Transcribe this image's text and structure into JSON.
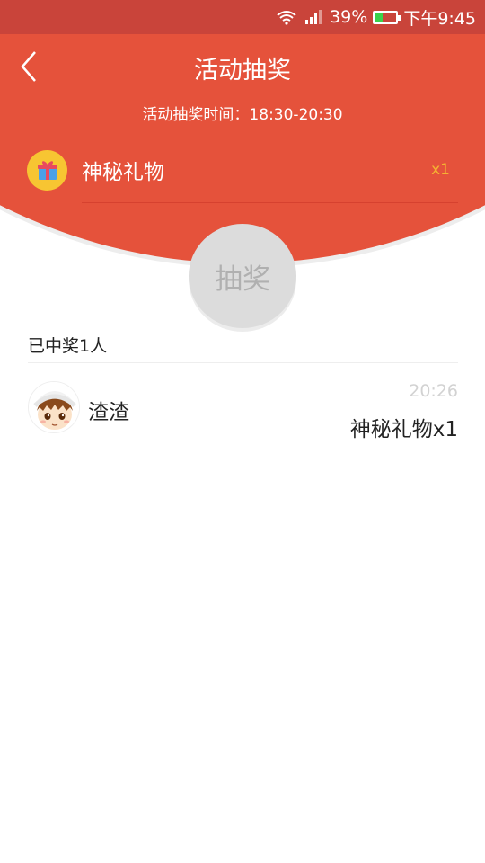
{
  "status_bar": {
    "battery_percent": "39%",
    "time": "下午9:45",
    "battery_level": 0.39,
    "battery_color": "#3ad14a"
  },
  "header": {
    "title": "活动抽奖",
    "subtitle": "活动抽奖时间：18:30-20:30",
    "back_icon": "chevron-left-icon",
    "background_color": "#e5523b"
  },
  "prize": {
    "name": "神秘礼物",
    "count": "x1",
    "icon": "gift-icon"
  },
  "draw_button": {
    "label": "抽奖"
  },
  "winners": {
    "summary": "已中奖1人",
    "items": [
      {
        "name": "渣渣",
        "time": "20:26",
        "prize": "神秘礼物x1",
        "avatar_icon": "cartoon-avatar-icon"
      }
    ]
  }
}
